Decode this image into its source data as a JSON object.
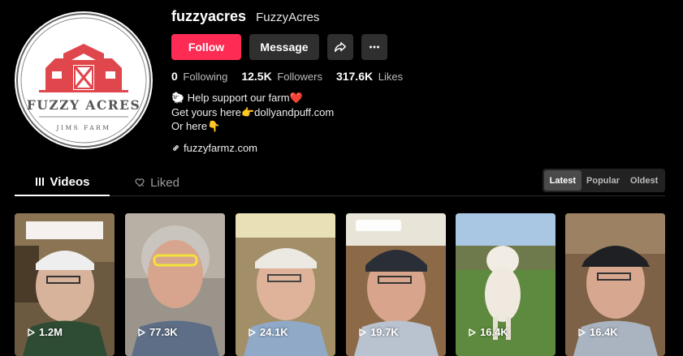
{
  "profile": {
    "username": "fuzzyacres",
    "nickname": "FuzzyAcres",
    "avatar": {
      "wordmark": "FUZZY ACRES",
      "submark": "JIMS FARM",
      "accent": "#e0474c"
    }
  },
  "actions": {
    "follow_label": "Follow",
    "message_label": "Message",
    "share_icon": "share-icon",
    "more_icon": "more-icon"
  },
  "stats": {
    "following": {
      "value": "0",
      "label": "Following"
    },
    "followers": {
      "value": "12.5K",
      "label": "Followers"
    },
    "likes": {
      "value": "317.6K",
      "label": "Likes"
    }
  },
  "bio": {
    "line1": "🐑 Help support our farm❤️",
    "line2": "Get yours here👉dollyandpuff.com",
    "line3": "Or here👇"
  },
  "link": {
    "text": "fuzzyfarmz.com",
    "icon": "link-icon"
  },
  "tabs": [
    {
      "label": "Videos",
      "icon": "grid-icon"
    },
    {
      "label": "Liked",
      "icon": "heart-icon"
    }
  ],
  "sort": [
    "Latest",
    "Popular",
    "Oldest"
  ],
  "videos": [
    {
      "views": "1.2M"
    },
    {
      "views": "77.3K"
    },
    {
      "views": "24.1K"
    },
    {
      "views": "19.7K"
    },
    {
      "views": "16.4K"
    },
    {
      "views": "16.4K"
    }
  ],
  "colors": {
    "accent": "#fe2c55",
    "background": "#000000",
    "button": "#2f2f2f"
  }
}
